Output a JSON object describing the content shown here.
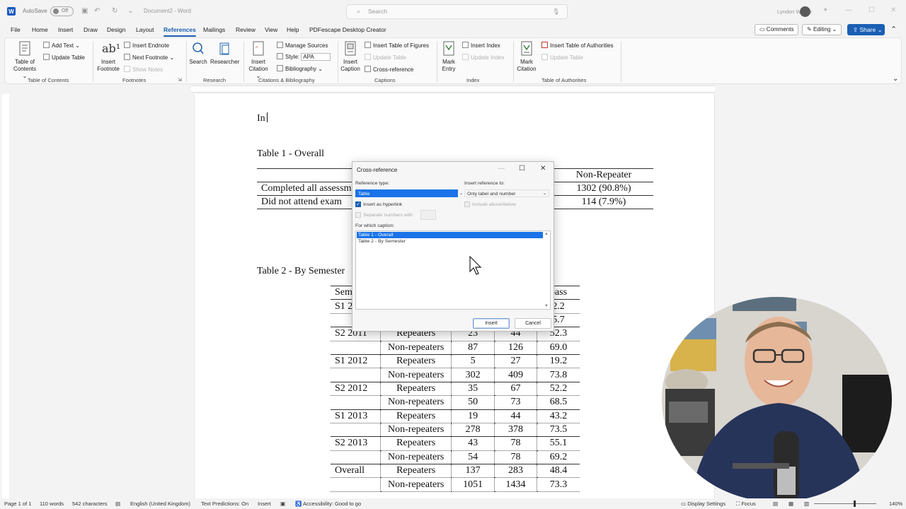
{
  "titlebar": {
    "autosave_label": "AutoSave",
    "autosave_state": "Off",
    "document_title": "Document2 - Word",
    "search_placeholder": "Search",
    "user_name": "Lyndon Walker"
  },
  "menu": {
    "tabs": [
      "File",
      "Home",
      "Insert",
      "Draw",
      "Design",
      "Layout",
      "References",
      "Mailings",
      "Review",
      "View",
      "Help",
      "PDFescape Desktop Creator"
    ],
    "active_tab": "References",
    "comments_label": "Comments",
    "editing_label": "Editing",
    "share_label": "Share"
  },
  "ribbon": {
    "toc": {
      "big_label_1": "Table of",
      "big_label_2": "Contents",
      "add_text": "Add Text",
      "update_table": "Update Table",
      "group": "Table of Contents"
    },
    "footnotes": {
      "big_label_1": "Insert",
      "big_label_2": "Footnote",
      "insert_endnote": "Insert Endnote",
      "next_footnote": "Next Footnote",
      "show_notes": "Show Notes",
      "group": "Footnotes"
    },
    "research": {
      "search": "Search",
      "researcher": "Researcher",
      "group": "Research"
    },
    "citations": {
      "big_label_1": "Insert",
      "big_label_2": "Citation",
      "manage_sources": "Manage Sources",
      "style_label": "Style:",
      "style_value": "APA",
      "bibliography": "Bibliography",
      "group": "Citations & Bibliography"
    },
    "captions": {
      "big_label_1": "Insert",
      "big_label_2": "Caption",
      "insert_tof": "Insert Table of Figures",
      "update_table": "Update Table",
      "cross_reference": "Cross-reference",
      "group": "Captions"
    },
    "index": {
      "big_label_1": "Mark",
      "big_label_2": "Entry",
      "insert_index": "Insert Index",
      "update_index": "Update Index",
      "group": "Index"
    },
    "authorities": {
      "big_label_1": "Mark",
      "big_label_2": "Citation",
      "insert_toa": "Insert Table of Authorities",
      "update_table": "Update Table",
      "group": "Table of Authorities"
    }
  },
  "document": {
    "typed_text": "In",
    "table1_caption": "Table 1 - Overall",
    "table1": {
      "header": [
        "",
        "Non-Repeater"
      ],
      "rows": [
        [
          "Completed all assessm",
          "1302 (90.8%)"
        ],
        [
          "Did not attend exam",
          "114 (7.9%)"
        ]
      ]
    },
    "table2_caption": "Table 2 - By Semester",
    "table2": {
      "header": [
        "Sem",
        "",
        "",
        "pass"
      ],
      "rows": [
        [
          "S1 2",
          "",
          "",
          "",
          "2.2"
        ],
        [
          "",
          "",
          "",
          "",
          "5.7"
        ],
        [
          "S2 2011",
          "Repeaters",
          "23",
          "44",
          "52.3"
        ],
        [
          "",
          "Non-repeaters",
          "87",
          "126",
          "69.0"
        ],
        [
          "S1 2012",
          "Repeaters",
          "5",
          "27",
          "19.2"
        ],
        [
          "",
          "Non-repeaters",
          "302",
          "409",
          "73.8"
        ],
        [
          "S2 2012",
          "Repeaters",
          "35",
          "67",
          "52.2"
        ],
        [
          "",
          "Non-repeaters",
          "50",
          "73",
          "68.5"
        ],
        [
          "S1 2013",
          "Repeaters",
          "19",
          "44",
          "43.2"
        ],
        [
          "",
          "Non-repeaters",
          "278",
          "378",
          "73.5"
        ],
        [
          "S2 2013",
          "Repeaters",
          "43",
          "78",
          "55.1"
        ],
        [
          "",
          "Non-repeaters",
          "54",
          "78",
          "69.2"
        ],
        [
          "Overall",
          "Repeaters",
          "137",
          "283",
          "48.4"
        ],
        [
          "",
          "Non-repeaters",
          "1051",
          "1434",
          "73.3"
        ]
      ]
    }
  },
  "dialog": {
    "title": "Cross-reference",
    "reference_type_label": "Reference type:",
    "reference_type_value": "Table",
    "insert_reference_label": "Insert reference to:",
    "insert_reference_value": "Only label and number",
    "insert_hyperlink_label": "Insert as hyperlink",
    "include_above_below_label": "Include above/below",
    "separate_numbers_label": "Separate numbers with",
    "which_caption_label": "For which caption:",
    "captions": [
      "Table 1 - Overall",
      "Table 2 - By Semester"
    ],
    "insert_button": "Insert",
    "cancel_button": "Cancel"
  },
  "statusbar": {
    "page": "Page 1 of 1",
    "words": "110 words",
    "characters": "542 characters",
    "language": "English (United Kingdom)",
    "text_predictions": "Text Predictions: On",
    "mode": "Insert",
    "accessibility": "Accessibility: Good to go",
    "display_settings": "Display Settings",
    "focus": "Focus",
    "zoom": "140%"
  },
  "colors": {
    "accent": "#1a5fb4",
    "selection": "#1a73e8"
  }
}
